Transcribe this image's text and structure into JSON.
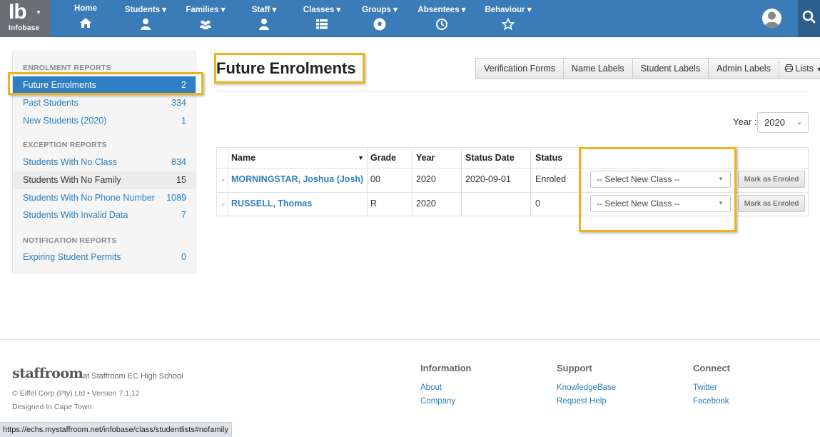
{
  "brand": {
    "logo": "Ib",
    "name": "Infobase"
  },
  "nav": [
    {
      "label": "Home",
      "icon": "home-icon"
    },
    {
      "label": "Students",
      "icon": "student-icon"
    },
    {
      "label": "Families",
      "icon": "family-icon"
    },
    {
      "label": "Staff",
      "icon": "staff-icon"
    },
    {
      "label": "Classes",
      "icon": "classes-icon"
    },
    {
      "label": "Groups",
      "icon": "groups-icon"
    },
    {
      "label": "Absentees",
      "icon": "clock-icon"
    },
    {
      "label": "Behaviour",
      "icon": "star-icon"
    }
  ],
  "sidebar": {
    "sections": [
      {
        "title": "ENROLMENT REPORTS",
        "items": [
          {
            "label": "Future Enrolments",
            "count": "2"
          },
          {
            "label": "Past Students",
            "count": "334"
          },
          {
            "label": "New Students (2020)",
            "count": "1"
          }
        ]
      },
      {
        "title": "EXCEPTION REPORTS",
        "items": [
          {
            "label": "Students With No Class",
            "count": "834"
          },
          {
            "label": "Students With No Family",
            "count": "15"
          },
          {
            "label": "Students With No Phone Number",
            "count": "1089"
          },
          {
            "label": "Students With Invalid Data",
            "count": "7"
          }
        ]
      },
      {
        "title": "NOTIFICATION REPORTS",
        "items": [
          {
            "label": "Expiring Student Permits",
            "count": "0"
          }
        ]
      }
    ]
  },
  "main": {
    "title": "Future Enrolments",
    "buttons": [
      "Verification Forms",
      "Name Labels",
      "Student Labels",
      "Admin Labels",
      "Lists"
    ],
    "year_label": "Year :",
    "year_value": "2020",
    "columns": [
      "Name",
      "Grade",
      "Year",
      "Status Date",
      "Status"
    ],
    "rows": [
      {
        "sex": "♂",
        "name": "MORNINGSTAR, Joshua (Josh)",
        "grade": "00",
        "year": "2020",
        "status_date": "2020-09-01",
        "status": "Enroled",
        "select": "-- Select New Class --",
        "action": "Mark as Enroled"
      },
      {
        "sex": "♂",
        "name": "RUSSELL, Thomas",
        "grade": "R",
        "year": "2020",
        "status_date": "",
        "status": "0",
        "select": "-- Select New Class --",
        "action": "Mark as Enroled"
      }
    ]
  },
  "footer": {
    "logo": "staffroom",
    "school": "at Staffroom EC High School",
    "copyright": "© Eiffel Corp (Pty) Ltd • Version 7.1.12",
    "designed": "Designed In Cape Town",
    "columns": [
      {
        "title": "Information",
        "links": [
          "About",
          "Company"
        ]
      },
      {
        "title": "Support",
        "links": [
          "KnowledgeBase",
          "Request Help"
        ]
      },
      {
        "title": "Connect",
        "links": [
          "Twitter",
          "Facebook"
        ]
      }
    ]
  },
  "statusbar": {
    "url": "https://echs.mystaffroom.net/infobase/class/studentlists#nofamily"
  },
  "colors": {
    "navbar": "#3a7bb8",
    "active": "#2f7fc4",
    "highlight": "#f0b21c",
    "link": "#2a7fc1"
  }
}
